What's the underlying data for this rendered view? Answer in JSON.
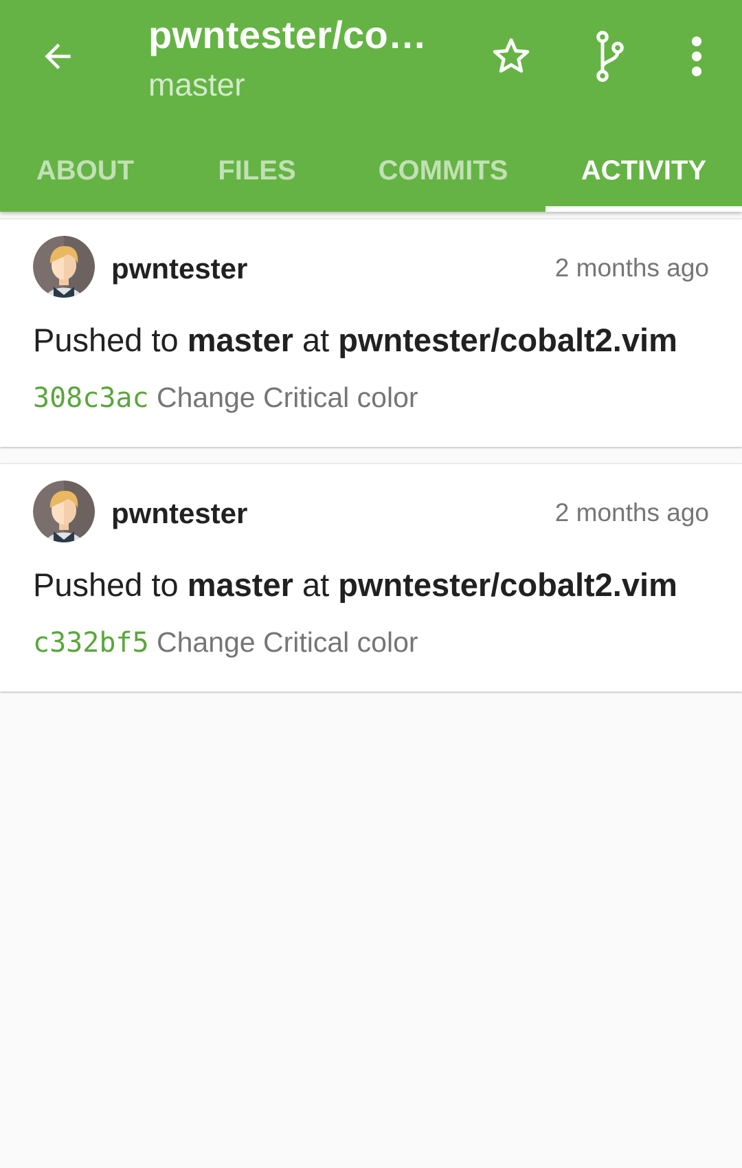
{
  "colors": {
    "primary": "#65b345",
    "sha": "#5aa63c",
    "background": "#fafafa"
  },
  "toolbar": {
    "back_icon": "arrow-back-icon",
    "title": "pwntester/co…",
    "subtitle": "master",
    "actions": [
      "star-icon",
      "branch-icon",
      "more-vert-icon"
    ]
  },
  "tabs": [
    {
      "label": "ABOUT",
      "selected": false
    },
    {
      "label": "FILES",
      "selected": false
    },
    {
      "label": "COMMITS",
      "selected": false
    },
    {
      "label": "ACTIVITY",
      "selected": true
    }
  ],
  "events": [
    {
      "user": "pwntester",
      "time": "2 months ago",
      "action_prefix": "Pushed to",
      "branch": "master",
      "at": "at",
      "repo": "pwntester/cobalt2.vim",
      "sha": "308c3ac",
      "message": "Change Critical color"
    },
    {
      "user": "pwntester",
      "time": "2 months ago",
      "action_prefix": "Pushed to",
      "branch": "master",
      "at": "at",
      "repo": "pwntester/cobalt2.vim",
      "sha": "c332bf5",
      "message": "Change Critical color"
    }
  ]
}
